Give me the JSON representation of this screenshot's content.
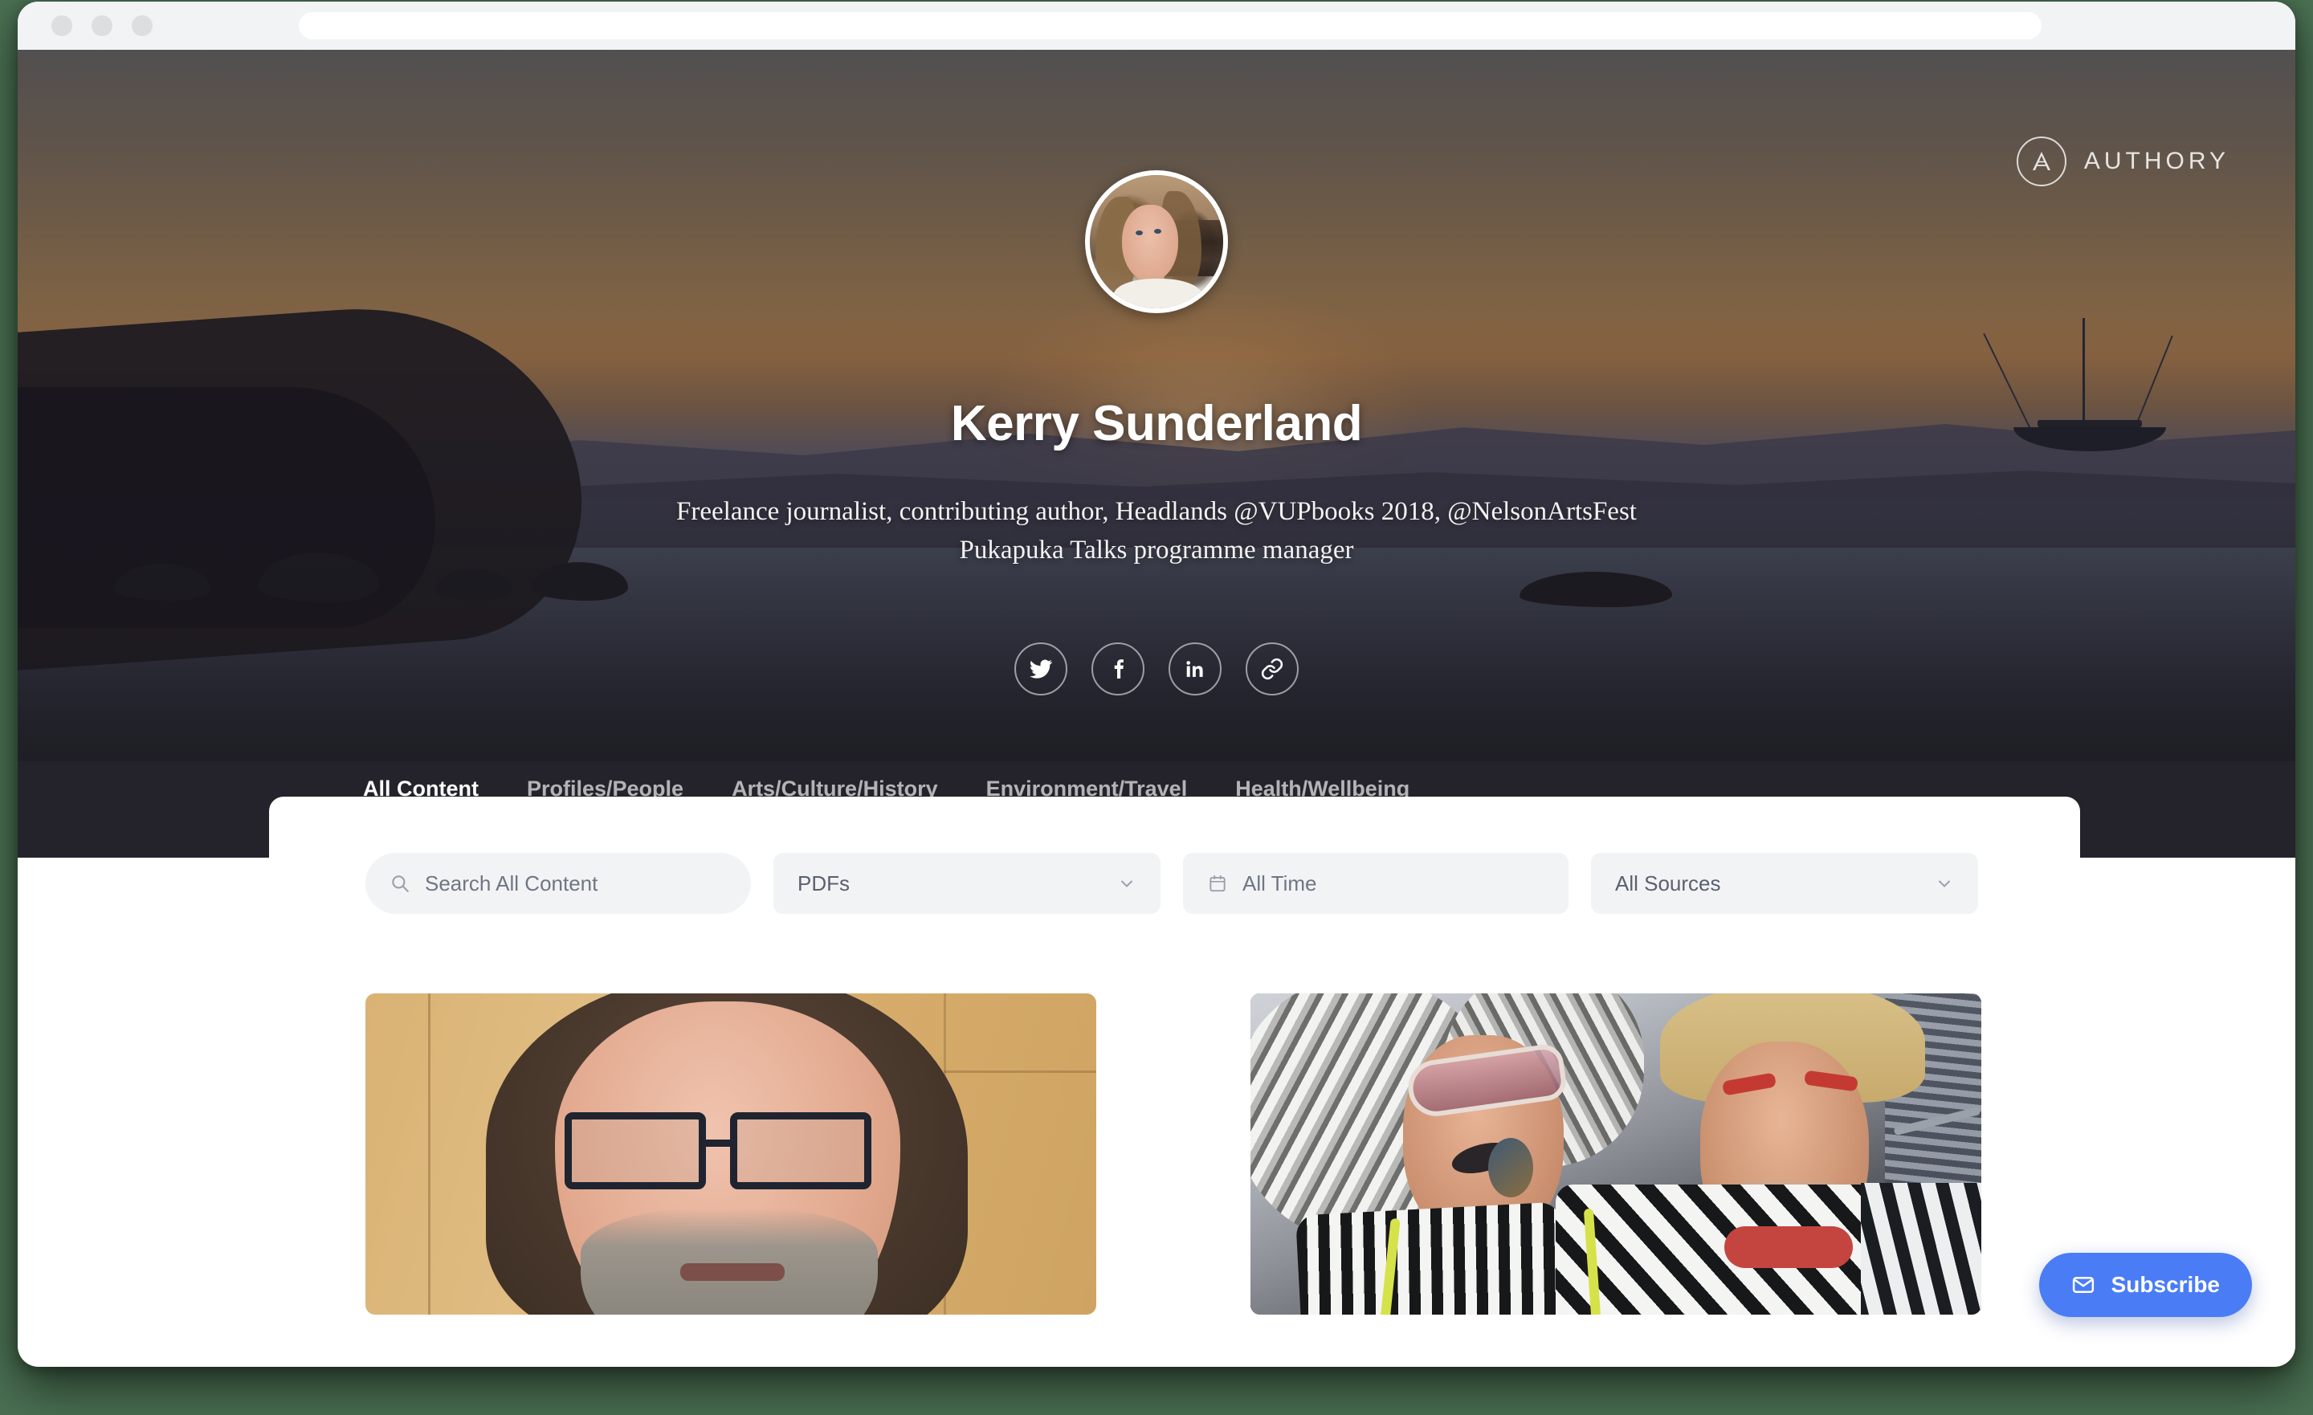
{
  "browser": {
    "url_value": "",
    "url_placeholder": "",
    "traffic_lights": [
      "close",
      "minimize",
      "maximize"
    ]
  },
  "brand": {
    "name": "AUTHORY",
    "mark": "authory-a-mark"
  },
  "profile": {
    "name": "Kerry Sunderland",
    "tagline_line1": "Freelance journalist, contributing author, Headlands @VUPbooks 2018, @NelsonArtsFest",
    "tagline_line2": "Pukapuka Talks programme manager",
    "avatar_alt": "Kerry Sunderland profile photo",
    "socials": [
      {
        "name": "twitter",
        "icon": "twitter-icon"
      },
      {
        "name": "facebook",
        "icon": "facebook-icon"
      },
      {
        "name": "linkedin",
        "icon": "linkedin-icon"
      },
      {
        "name": "website",
        "icon": "link-icon"
      }
    ]
  },
  "tabs": [
    {
      "label": "All Content",
      "active": true
    },
    {
      "label": "Profiles/People",
      "active": false
    },
    {
      "label": "Arts/Culture/History",
      "active": false
    },
    {
      "label": "Environment/Travel",
      "active": false
    },
    {
      "label": "Health/Wellbeing",
      "active": false
    }
  ],
  "filters": {
    "search": {
      "placeholder": "Search All Content",
      "value": "",
      "icon": "search-icon"
    },
    "type": {
      "value": "PDFs",
      "icon": "chevron-down-icon"
    },
    "time": {
      "value": "All Time",
      "icon": "calendar-icon"
    },
    "sources": {
      "value": "All Sources",
      "icon": "chevron-down-icon"
    }
  },
  "cards": [
    {
      "alt": "Portrait of a bearded man wearing dark-rimmed glasses against a wooden wall"
    },
    {
      "alt": "Two costumed festival-goers in black and white striped outfits with silver wigs"
    }
  ],
  "subscribe": {
    "label": "Subscribe",
    "icon": "envelope-icon"
  },
  "colors": {
    "accent_blue": "#4a7cf6",
    "page_background": "#4a7052",
    "panel_white": "#ffffff",
    "hero_dark": "#24232b",
    "filter_grey": "#f2f3f5"
  }
}
